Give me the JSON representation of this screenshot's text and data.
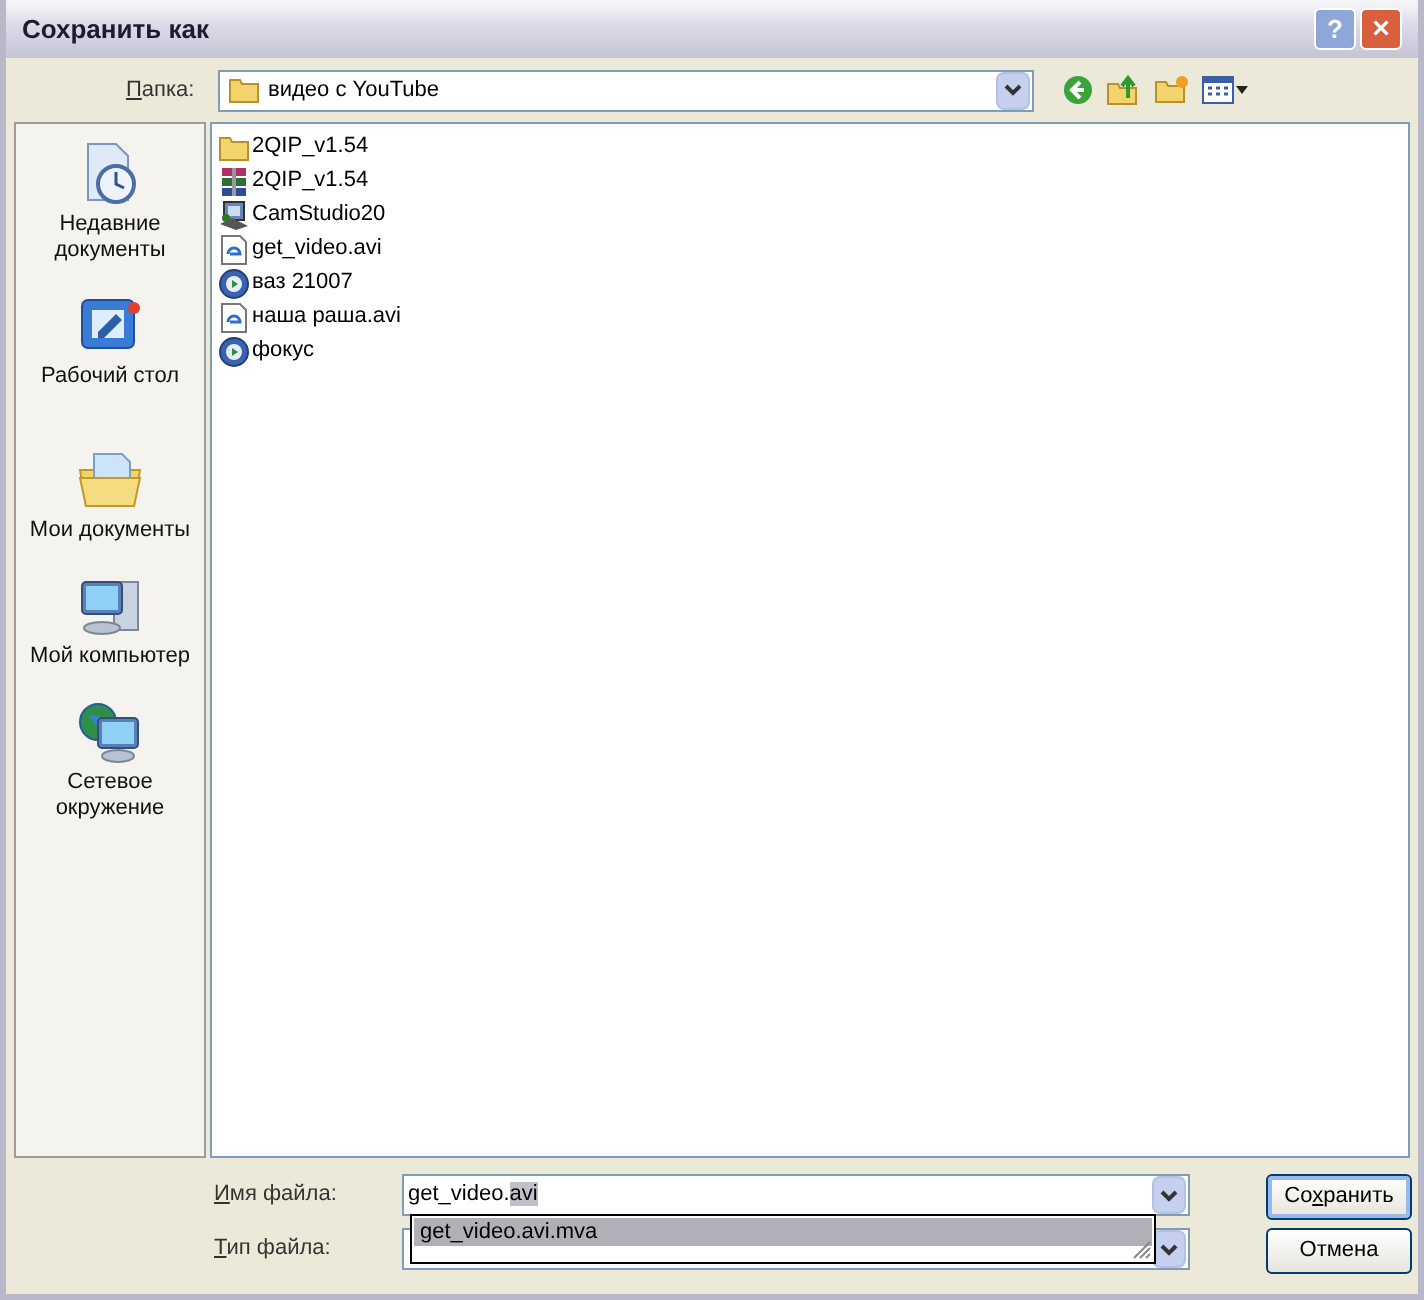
{
  "window": {
    "title": "Сохранить как"
  },
  "title_buttons": [
    {
      "kind": "help",
      "label": "?"
    },
    {
      "kind": "close",
      "label": "×"
    }
  ],
  "folder_bar": {
    "hotkey": "П",
    "label_rest": "апка:",
    "value": "видео с YouTube"
  },
  "places": [
    {
      "kind": "recent",
      "label": "Недавние документы"
    },
    {
      "kind": "desktop",
      "label": "Рабочий стол"
    },
    {
      "kind": "documents",
      "label": "Мои документы"
    },
    {
      "kind": "computer",
      "label": "Мой компьютер"
    },
    {
      "kind": "network",
      "label": "Сетевое окружение"
    }
  ],
  "files": [
    {
      "kind": "folder",
      "name": "2QIP_v1.54"
    },
    {
      "kind": "archive",
      "name": "2QIP_v1.54"
    },
    {
      "kind": "program",
      "name": "CamStudio20"
    },
    {
      "kind": "ie",
      "name": "get_video.avi"
    },
    {
      "kind": "media",
      "name": "ваз 21007"
    },
    {
      "kind": "ie",
      "name": "наша раша.avi"
    },
    {
      "kind": "media",
      "name": "фокус"
    }
  ],
  "file_name": {
    "hotkey": "И",
    "label_rest": "мя файла:",
    "text_before": "get_video.",
    "selected_text": "avi"
  },
  "file_type": {
    "hotkey": "Т",
    "label_rest": "ип файла:"
  },
  "suggestions": [
    {
      "text": "get_video.avi.mva",
      "selected": true
    }
  ],
  "buttons": [
    {
      "rest_before": "Со",
      "underlined": "х",
      "rest_after": "ранить",
      "default": true
    },
    {
      "rest_before": "Отмена",
      "default": false
    }
  ]
}
